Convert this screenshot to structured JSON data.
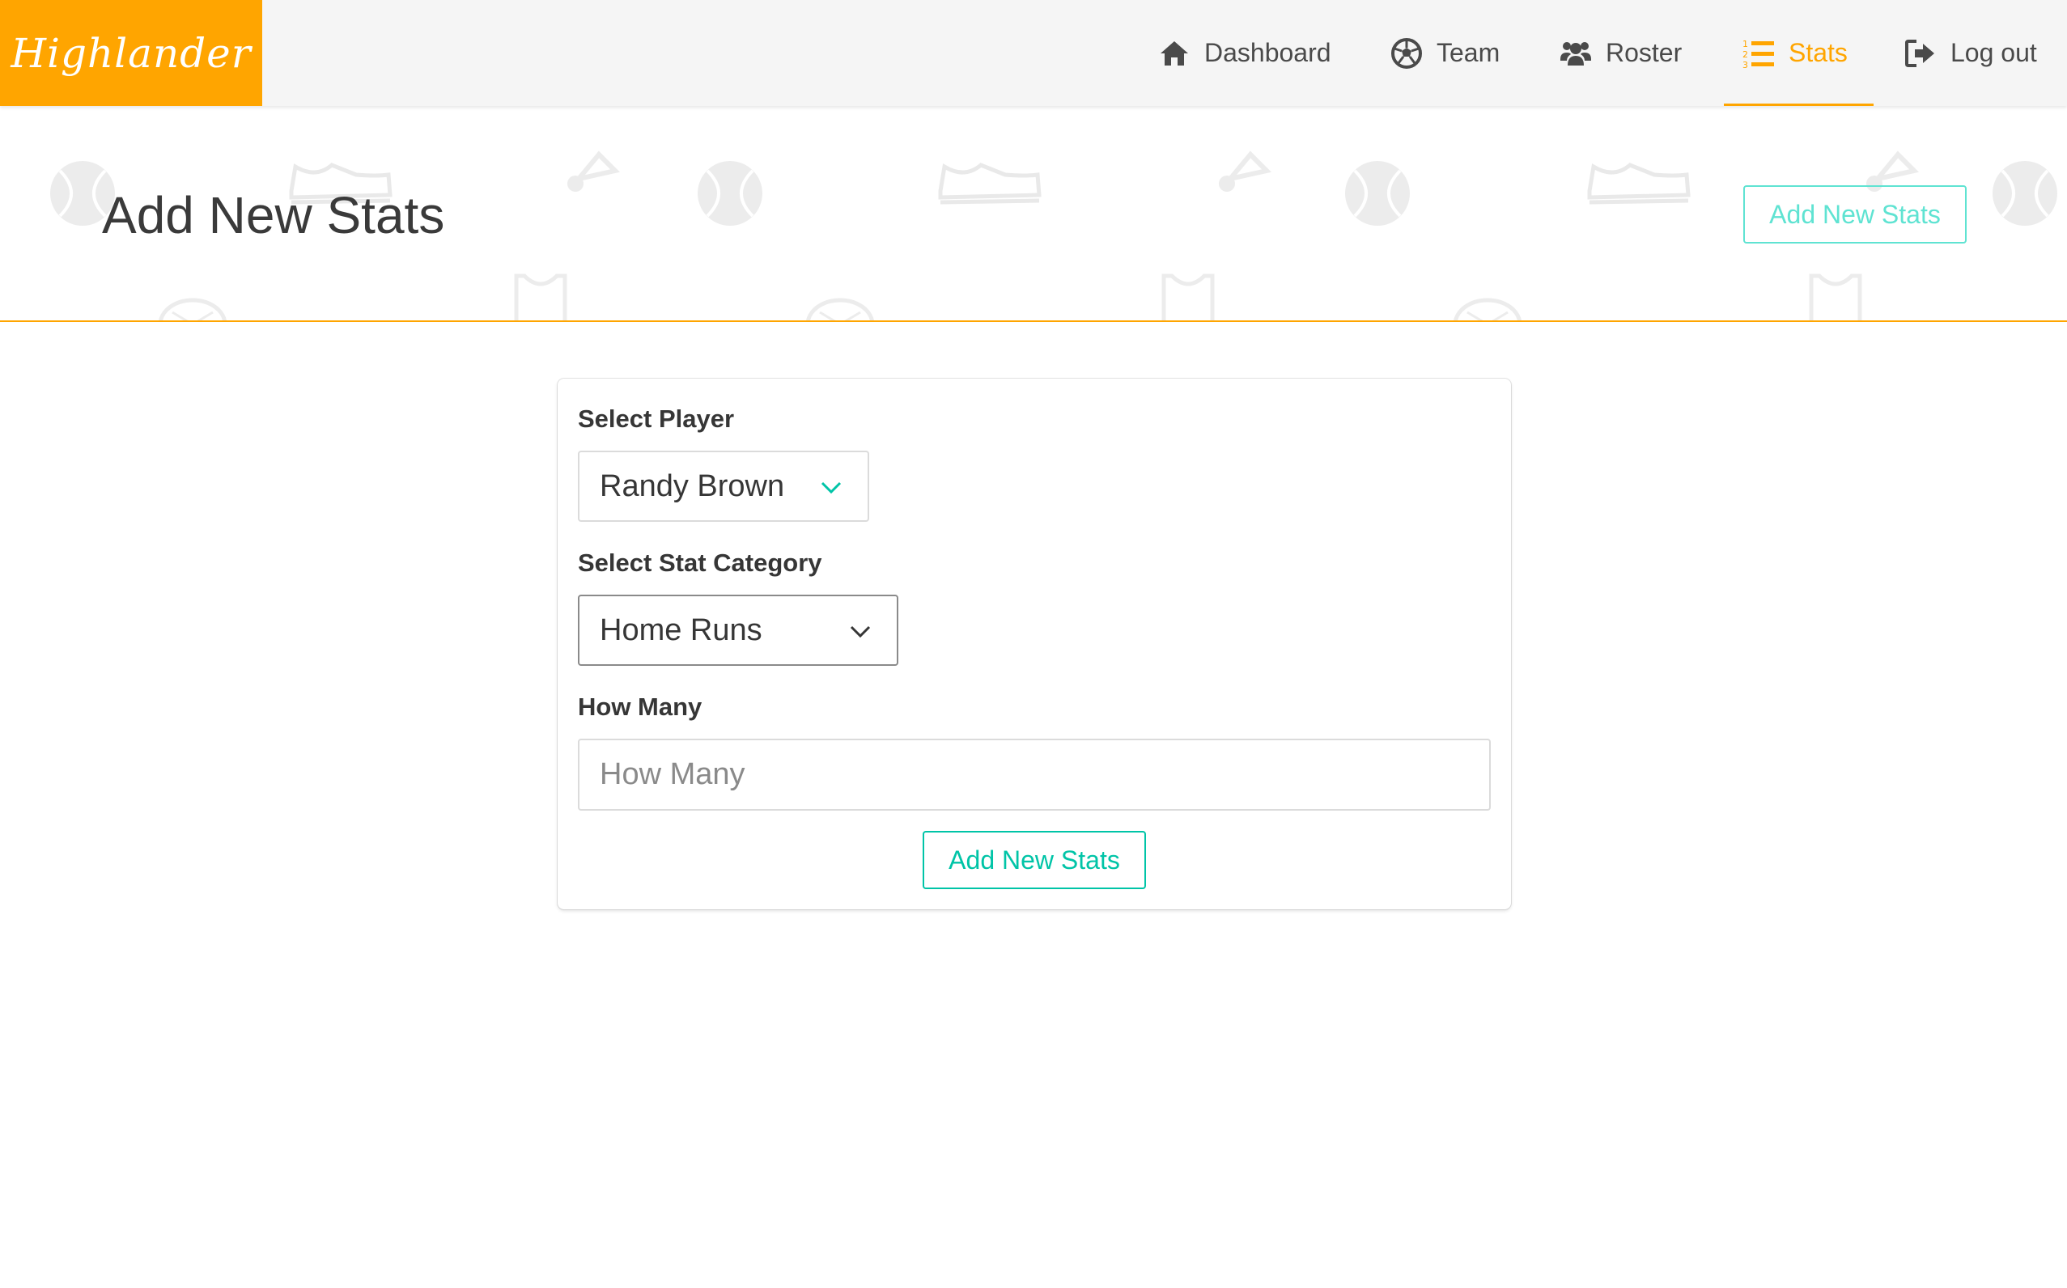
{
  "app": {
    "brand": "Highlander"
  },
  "nav": {
    "items": [
      {
        "label": "Dashboard",
        "icon": "home-icon",
        "active": false
      },
      {
        "label": "Team",
        "icon": "soccer-ball-icon",
        "active": false
      },
      {
        "label": "Roster",
        "icon": "users-icon",
        "active": false
      },
      {
        "label": "Stats",
        "icon": "numbered-list-icon",
        "active": true
      },
      {
        "label": "Log out",
        "icon": "sign-out-icon",
        "active": false
      }
    ]
  },
  "hero": {
    "title": "Add New Stats",
    "button_label": "Add New Stats"
  },
  "form": {
    "player": {
      "label": "Select Player",
      "value": "Randy Brown"
    },
    "category": {
      "label": "Select Stat Category",
      "value": "Home Runs"
    },
    "how_many": {
      "label": "How Many",
      "placeholder": "How Many",
      "value": ""
    },
    "submit_label": "Add New Stats"
  },
  "colors": {
    "brand": "#ffa500",
    "accent": "#00c4a7",
    "accent_light": "#5fe3d2",
    "text": "#363636",
    "navbar_bg": "#f5f5f5"
  }
}
